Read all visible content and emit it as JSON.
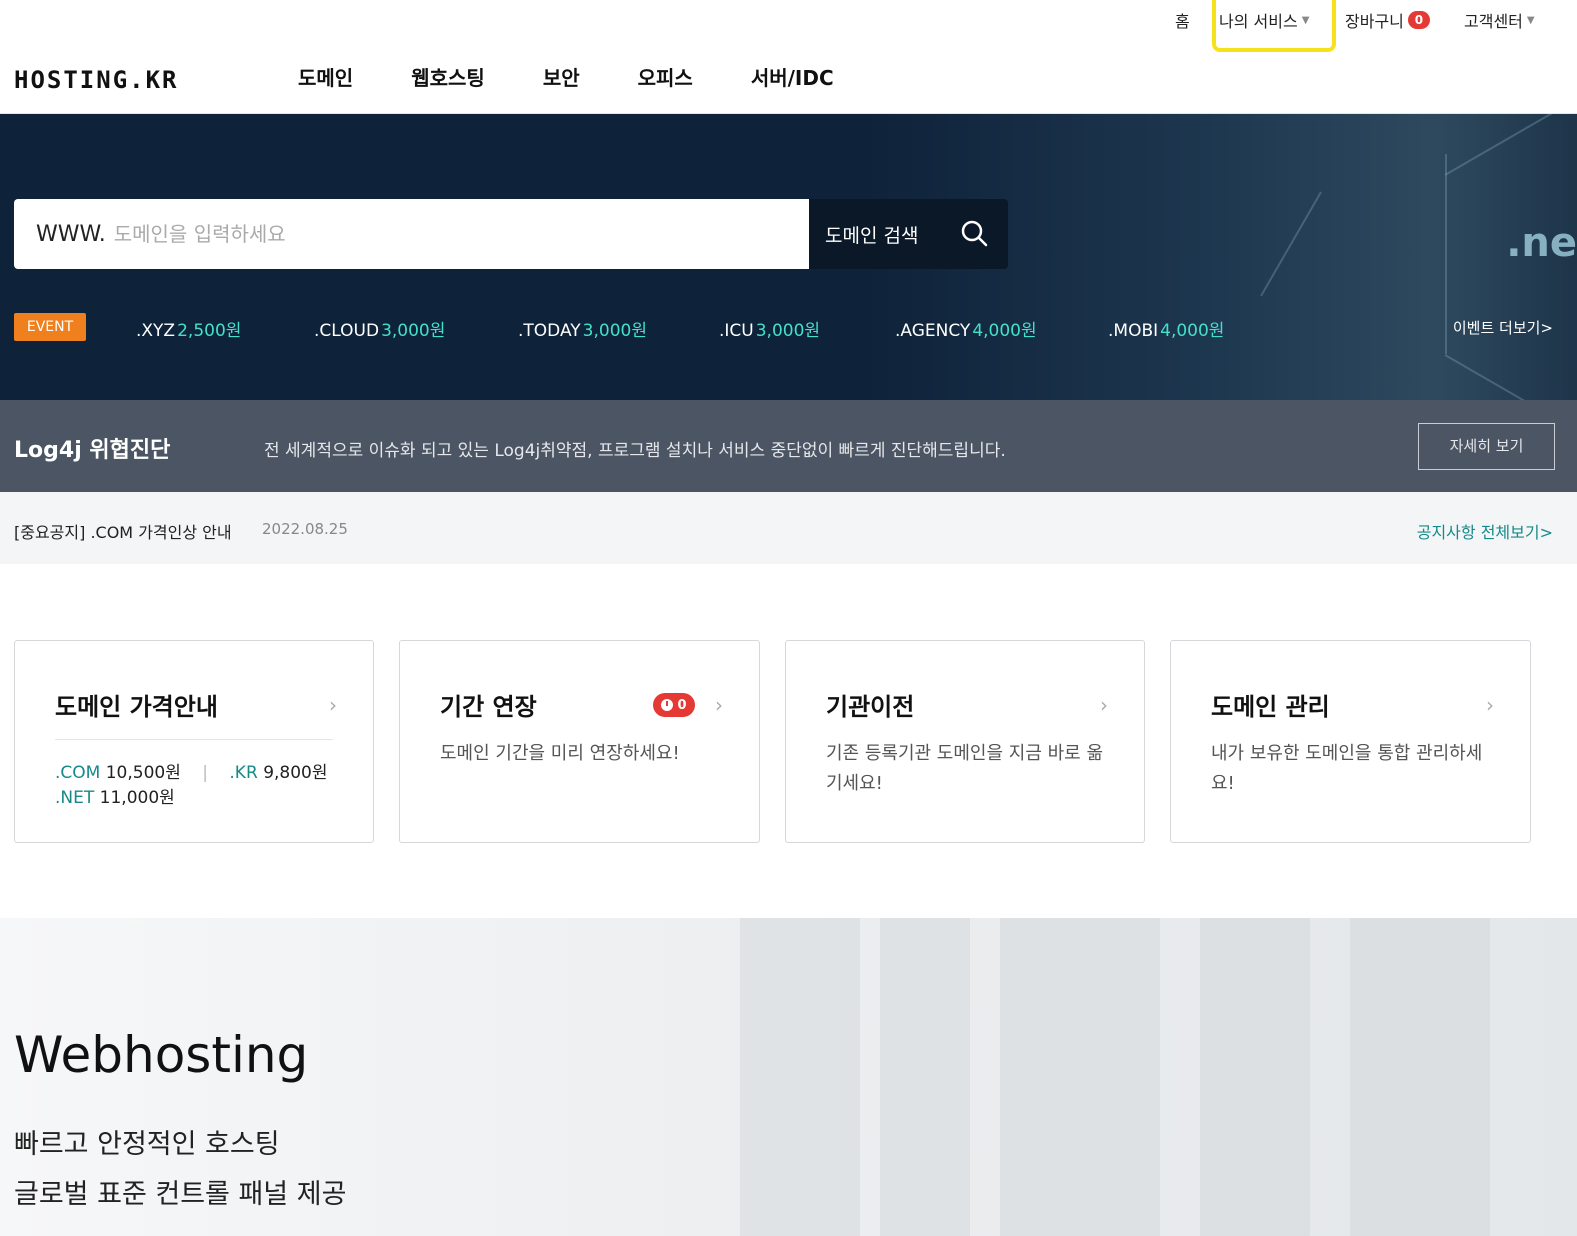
{
  "util_nav": {
    "home": "홈",
    "my_service": "나의 서비스",
    "cart": "장바구니",
    "cart_count": "0",
    "support": "고객센터"
  },
  "header": {
    "logo": "HOSTING.KR",
    "nav": [
      "도메인",
      "웹호스팅",
      "보안",
      "오피스",
      "서버/IDC"
    ]
  },
  "hero": {
    "search_prefix": "WWW.",
    "search_placeholder": "도메인을 입력하세요",
    "search_button": "도메인 검색",
    "event_label": "EVENT",
    "events": [
      {
        "tld": ".XYZ",
        "price": "2,500원"
      },
      {
        "tld": ".CLOUD",
        "price": "3,000원"
      },
      {
        "tld": ".TODAY",
        "price": "3,000원"
      },
      {
        "tld": ".ICU",
        "price": "3,000원"
      },
      {
        "tld": ".AGENCY",
        "price": "4,000원"
      },
      {
        "tld": ".MOBI",
        "price": "4,000원"
      }
    ],
    "event_more": "이벤트 더보기>",
    "deco_text": ".ne"
  },
  "log4j": {
    "title": "Log4j 위협진단",
    "desc": "전 세계적으로 이슈화 되고 있는 Log4j취약점, 프로그램 설치나 서비스 중단없이 빠르게 진단해드립니다.",
    "button": "자세히 보기"
  },
  "notice": {
    "text": "[중요공지] .COM 가격인상 안내",
    "date": "2022.08.25",
    "more": "공지사항 전체보기>"
  },
  "cards": {
    "price": {
      "title": "도메인 가격안내",
      "items": [
        {
          "tld": ".COM",
          "price": "10,500원"
        },
        {
          "tld": ".KR",
          "price": "9,800원"
        },
        {
          "tld": ".NET",
          "price": "11,000원"
        }
      ]
    },
    "renew": {
      "title": "기간 연장",
      "badge": "0",
      "desc": "도메인 기간을 미리 연장하세요!"
    },
    "transfer": {
      "title": "기관이전",
      "desc": "기존 등록기관 도메인을 지금 바로 옮기세요!"
    },
    "manage": {
      "title": "도메인 관리",
      "desc": "내가 보유한 도메인을 통합 관리하세요!"
    },
    "arrow": "›"
  },
  "webhosting": {
    "title": "Webhosting",
    "lines": [
      "빠르고 안정적인 호스팅",
      "글로벌 표준 컨트롤 패널 제공"
    ]
  },
  "colors": {
    "hero_bg": "#0e2239",
    "event_orange": "#f07f1e",
    "price_accent": "#44e0c8",
    "teal_link": "#168a8a",
    "badge_red": "#e53935",
    "highlight_yellow": "#f5e21c"
  }
}
